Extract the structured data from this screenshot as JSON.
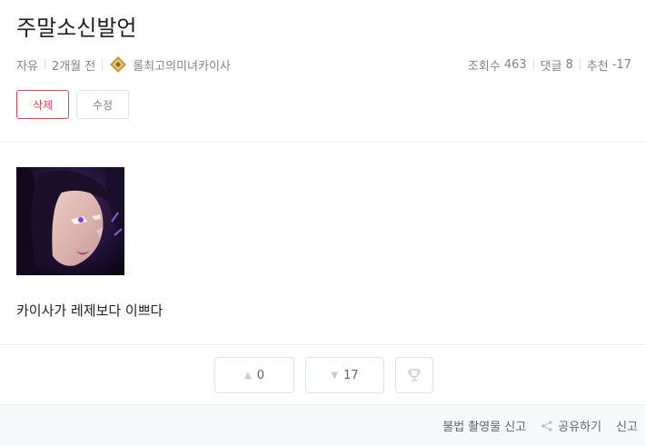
{
  "post": {
    "title": "주말소신발언",
    "category": "자유",
    "time_ago": "2개월 전",
    "author": "롤최고의미녀카이사",
    "body": "카이사가 레제보다 이쁘다"
  },
  "stats": {
    "views_label": "조회수",
    "views": "463",
    "comments_label": "댓글",
    "comments": "8",
    "recommend_label": "추천",
    "recommend": "-17"
  },
  "actions": {
    "delete_label": "삭제",
    "edit_label": "수정"
  },
  "votes": {
    "up_count": "0",
    "down_count": "17"
  },
  "footer": {
    "report_illegal_label": "불법 촬영물 신고",
    "share_label": "공유하기",
    "report_label": "신고"
  },
  "icons": {
    "rank": "rank-emblem-icon",
    "upvote": "triangle-up-icon",
    "downvote": "triangle-down-icon",
    "trophy": "trophy-icon",
    "share": "share-icon"
  },
  "colors": {
    "accent_red": "#e84057",
    "muted_text": "#7b858e",
    "border": "#dde2e6",
    "rank_gold": "#c89b3c"
  }
}
